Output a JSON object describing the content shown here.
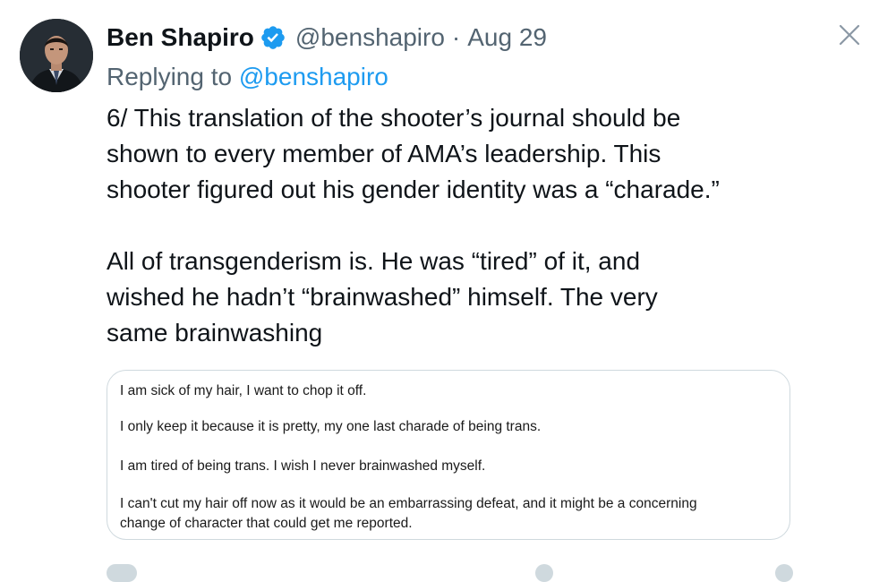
{
  "tweet": {
    "author_name": "Ben Shapiro",
    "handle": "@benshapiro",
    "separator": "·",
    "date": "Aug 29",
    "reply_prefix": "Replying to",
    "reply_handle": "@benshapiro",
    "body_lines": [
      "6/ This translation of the shooter’s journal should be",
      "shown to every member of AMA’s leadership. This",
      "shooter figured out his gender identity was a “charade.”",
      "All of transgenderism is. He was “tired” of it, and",
      "wished he hadn’t “brainwashed” himself. The very",
      "same brainwashing"
    ]
  },
  "media": {
    "journal_lines": [
      "I am sick of my hair, I want to chop it off.",
      "I only keep it because it is pretty, my one last charade of being trans.",
      "I am tired of being trans. I wish I never brainwashed myself.",
      "I can't cut my hair off now as it would be an embarrassing defeat, and it might be a concerning",
      "change of character that could get me reported."
    ]
  },
  "icons": {
    "verified": "verified-badge-icon",
    "close": "close-icon"
  },
  "colors": {
    "text": "#0f1419",
    "secondary": "#536471",
    "link": "#1d9bf0",
    "border": "#cfd9de",
    "verified": "#1d9bf0"
  }
}
